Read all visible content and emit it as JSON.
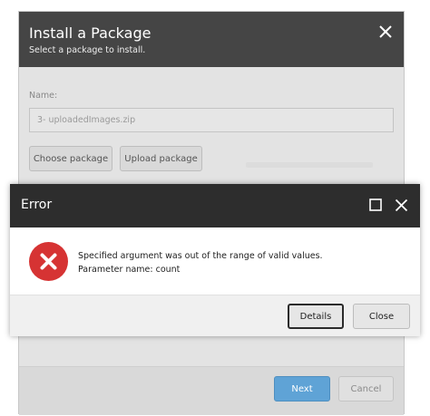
{
  "install_dialog": {
    "title": "Install a Package",
    "subtitle": "Select a package to install.",
    "name_label": "Name:",
    "name_value": "3- uploadedImages.zip",
    "choose_label": "Choose package",
    "upload_label": "Upload package",
    "next_label": "Next",
    "cancel_label": "Cancel",
    "icons": {
      "close": "close-icon"
    }
  },
  "error_dialog": {
    "title": "Error",
    "message_line1": "Specified argument was out of the range of valid values.",
    "message_line2": "Parameter name: count",
    "details_label": "Details",
    "close_label": "Close",
    "icons": {
      "error": "error-icon",
      "maximize": "maximize-icon",
      "close": "close-icon"
    }
  },
  "colors": {
    "header_dark": "#454545",
    "error_header": "#2d2d2d",
    "error_red": "#d63333",
    "next_blue": "#5fa3d6"
  }
}
